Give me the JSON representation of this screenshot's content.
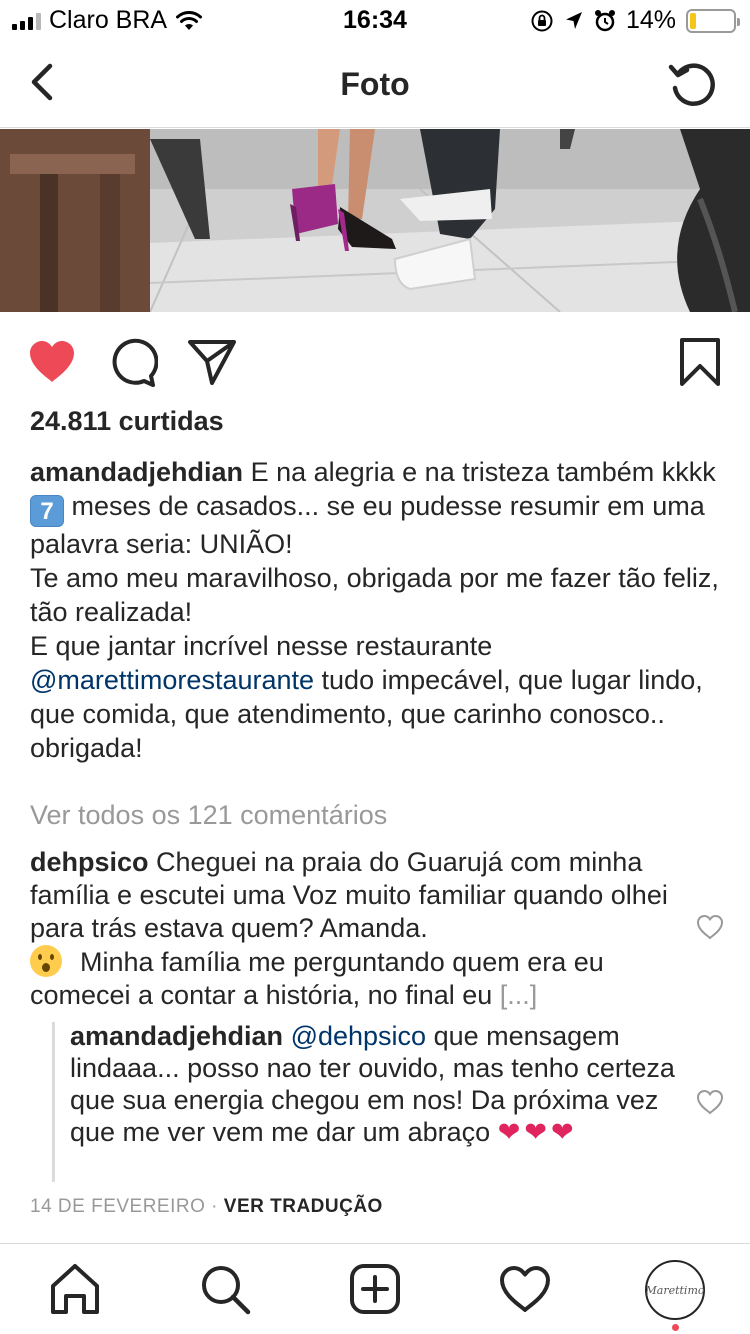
{
  "status_bar": {
    "carrier": "Claro BRA",
    "time": "16:34",
    "battery_percent": "14%",
    "battery_level": 0.14,
    "signal_bars_filled": 3,
    "icons": [
      "wifi-icon",
      "rotation-lock-icon",
      "location-icon",
      "alarm-icon",
      "battery-icon"
    ]
  },
  "nav": {
    "title": "Foto",
    "back_icon": "chevron-left-icon",
    "refresh_icon": "refresh-icon"
  },
  "post": {
    "likes": "24.811 curtidas",
    "caption": {
      "username": "amandadjehdian",
      "line1": "E na alegria e na tristeza também kkkk",
      "emoji": "7",
      "line2": "meses de casados... se eu pudesse resumir em uma palavra seria: UNIÃO!",
      "line3": "Te amo meu maravilhoso, obrigada por me fazer tão feliz, tão realizada!",
      "line4": "E que jantar incrível nesse restaurante",
      "mention": "@marettimorestaurante",
      "line5": "tudo impecável, que lugar lindo, que comida, que atendimento, que carinho conosco.. obrigada!"
    },
    "view_all_comments": "Ver todos os 121 comentários",
    "comment": {
      "username": "dehpsico",
      "text": "Cheguei na praia do Guarujá com minha família e escutei uma Voz muito familiar quando olhei para trás estava quem? Amanda.",
      "text2": "Minha família me perguntando quem era eu comecei a contar a história, no final eu",
      "more": "[...]"
    },
    "reply": {
      "username": "amandadjehdian",
      "mention": "@dehpsico",
      "text": "que mensagem lindaaa... posso nao ter ouvido, mas tenho certeza que sua energia chegou em nos! Da próxima vez que me ver vem me dar um abraço",
      "hearts": "❤❤❤"
    },
    "date": "14 DE FEVEREIRO",
    "separator": "·",
    "translate": "VER TRADUÇÃO"
  },
  "tabbar": {
    "items": [
      "home-icon",
      "search-icon",
      "new-post-icon",
      "activity-icon",
      "profile-avatar"
    ],
    "avatar_text": "Marettimo"
  },
  "colors": {
    "like_red": "#ed4956",
    "mention_blue": "#003569",
    "muted_gray": "#999999",
    "text": "#262626"
  }
}
